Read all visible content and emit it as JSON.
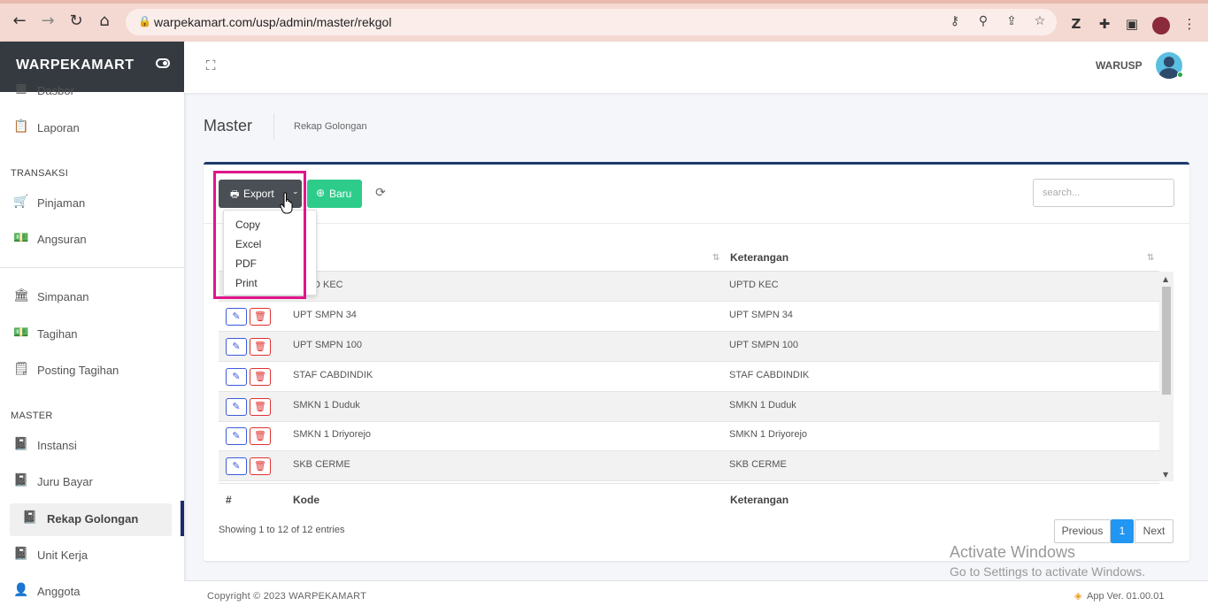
{
  "browser": {
    "url": "warpekamart.com/usp/admin/master/rekgol"
  },
  "sidebar": {
    "brand": "WARPEKAMART",
    "items_top": [
      {
        "label": "Dasbor"
      },
      {
        "label": "Laporan"
      }
    ],
    "section_transaksi": "TRANSAKSI",
    "items_transaksi": [
      {
        "label": "Pinjaman"
      },
      {
        "label": "Angsuran"
      }
    ],
    "items_mid": [
      {
        "label": "Simpanan"
      },
      {
        "label": "Tagihan"
      },
      {
        "label": "Posting Tagihan"
      }
    ],
    "section_master": "MASTER",
    "items_master": [
      {
        "label": "Instansi"
      },
      {
        "label": "Juru Bayar"
      },
      {
        "label": "Rekap Golongan"
      },
      {
        "label": "Unit Kerja"
      },
      {
        "label": "Anggota"
      }
    ]
  },
  "topbar": {
    "user_name": "WARUSP"
  },
  "header": {
    "title": "Master",
    "breadcrumb": "Rekap Golongan"
  },
  "toolbar": {
    "export_label": "Export",
    "new_label": "Baru",
    "search_placeholder": "search..."
  },
  "export_menu": [
    "Copy",
    "Excel",
    "PDF",
    "Print"
  ],
  "table": {
    "columns": [
      "#",
      "Kode",
      "Keterangan"
    ],
    "rows": [
      {
        "kode": "UPTD KEC",
        "keterangan": "UPTD KEC"
      },
      {
        "kode": "UPT SMPN 34",
        "keterangan": "UPT SMPN 34"
      },
      {
        "kode": "UPT SMPN 100",
        "keterangan": "UPT SMPN 100"
      },
      {
        "kode": "STAF CABDINDIK",
        "keterangan": "STAF CABDINDIK"
      },
      {
        "kode": "SMKN 1 Duduk",
        "keterangan": "SMKN 1 Duduk"
      },
      {
        "kode": "SMKN 1 Driyorejo",
        "keterangan": "SMKN 1 Driyorejo"
      },
      {
        "kode": "SKB CERME",
        "keterangan": "SKB CERME"
      }
    ],
    "partial_first_kode": "D KEC",
    "info": "Showing 1 to 12 of 12 entries"
  },
  "pagination": {
    "previous": "Previous",
    "current": "1",
    "next": "Next"
  },
  "watermark": {
    "line1": "Activate Windows",
    "line2": "Go to Settings to activate Windows."
  },
  "footer": {
    "copyright": "Copyright © 2023 WARPEKAMART",
    "version": "App Ver. 01.00.01"
  }
}
